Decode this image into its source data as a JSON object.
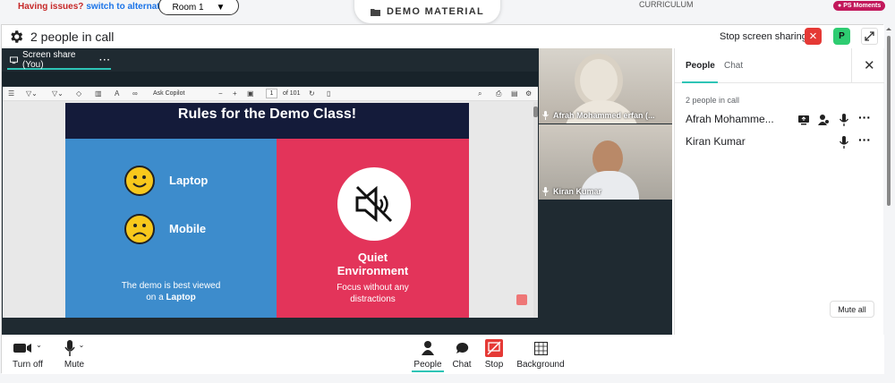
{
  "top": {
    "issue_text": "Having issues?",
    "issue_link": "switch to alternate room",
    "room_value": "Room 1",
    "demo_label": "DEMO MATERIAL",
    "curriculum_label": "CURRICULUM",
    "moments_label": "PS Moments"
  },
  "header": {
    "title": "2 people in call",
    "stop_share_label": "Stop screen sharing",
    "avatar_initial": "P"
  },
  "stage": {
    "screenshare_tab": "Screen share (You)",
    "pdf": {
      "ask_label": "Ask Copilot",
      "page_value": "1",
      "page_of": "of 101"
    },
    "slide": {
      "title": "Rules for the Demo Class!",
      "laptop_label": "Laptop",
      "mobile_label": "Mobile",
      "note_line1": "The demo is best viewed",
      "note_line2_prefix": "on a ",
      "note_line2_bold": "Laptop",
      "quiet_line1": "Quiet",
      "quiet_line2": "Environment",
      "quiet_sub1": "Focus without any",
      "quiet_sub2": "distractions"
    },
    "tiles": [
      {
        "name": "Afrah Mohammed erfan (..."
      },
      {
        "name": "Kiran Kumar"
      }
    ]
  },
  "panel": {
    "tab_people": "People",
    "tab_chat": "Chat",
    "count_text": "2 people in call",
    "participants": [
      {
        "name": "Afrah Mohamme..."
      },
      {
        "name": "Kiran Kumar"
      }
    ],
    "mute_all_label": "Mute all"
  },
  "controls": {
    "turn_off": "Turn off",
    "mute": "Mute",
    "people": "People",
    "chat": "Chat",
    "stop": "Stop",
    "background": "Background"
  },
  "colors": {
    "accent": "#2ec4b6",
    "danger": "#e53935",
    "slide_blue": "#3d8ccc",
    "slide_red": "#e3345a",
    "slide_navy": "#141b3a"
  }
}
